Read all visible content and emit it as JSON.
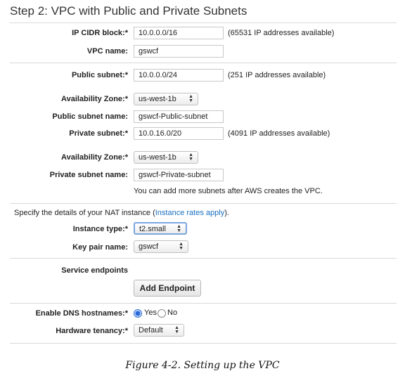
{
  "title": "Step 2: VPC with Public and Private Subnets",
  "vpc": {
    "cidr_label": "IP CIDR block:*",
    "cidr_value": "10.0.0.0/16",
    "cidr_note": "(65531 IP addresses available)",
    "name_label": "VPC name:",
    "name_value": "gswcf"
  },
  "public_subnet": {
    "label": "Public subnet:*",
    "value": "10.0.0.0/24",
    "note": "(251 IP addresses available)",
    "az_label": "Availability Zone:*",
    "az_value": "us-west-1b",
    "name_label": "Public subnet name:",
    "name_value": "gswcf-Public-subnet"
  },
  "private_subnet": {
    "label": "Private subnet:*",
    "value": "10.0.16.0/20",
    "note": "(4091 IP addresses available)",
    "az_label": "Availability Zone:*",
    "az_value": "us-west-1b",
    "name_label": "Private subnet name:",
    "name_value": "gswcf-Private-subnet",
    "more_note": "You can add more subnets after AWS creates the VPC."
  },
  "nat": {
    "intro_before": "Specify the details of your NAT instance (",
    "intro_link": "Instance rates apply",
    "intro_after": ").",
    "type_label": "Instance type:*",
    "type_value": "t2.small",
    "key_label": "Key pair name:",
    "key_value": "gswcf"
  },
  "endpoints": {
    "label": "Service endpoints",
    "button": "Add Endpoint"
  },
  "dns": {
    "label": "Enable DNS hostnames:*",
    "yes": "Yes",
    "no": "No",
    "selected": "Yes"
  },
  "tenancy": {
    "label": "Hardware tenancy:*",
    "value": "Default"
  },
  "caption": "Figure 4-2. Setting up the VPC"
}
